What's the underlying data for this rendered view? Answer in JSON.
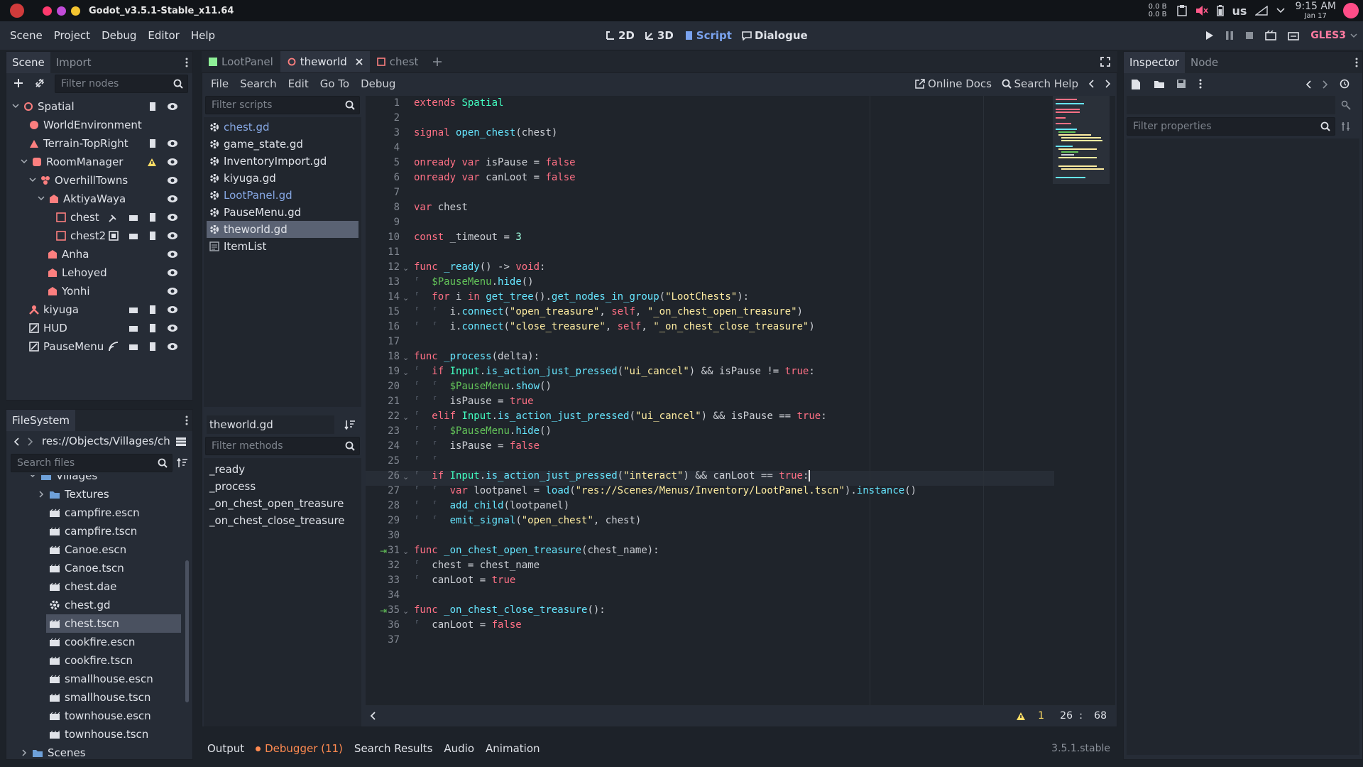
{
  "window": {
    "title": "Godot_v3.5.1-Stable_x11.64",
    "net_up": "0.0 B",
    "net_down": "0.0 B",
    "keyboard": "us",
    "time": "9:15 AM",
    "date": "Jan 17"
  },
  "menu": [
    "Scene",
    "Project",
    "Debug",
    "Editor",
    "Help"
  ],
  "workspaces": [
    {
      "label": "2D"
    },
    {
      "label": "3D"
    },
    {
      "label": "Script"
    },
    {
      "label": "Dialogue"
    }
  ],
  "renderer": "GLES3",
  "scene_dock": {
    "tabs": [
      "Scene",
      "Import"
    ],
    "filter_placeholder": "Filter nodes",
    "nodes": [
      {
        "label": "Spatial"
      },
      {
        "label": "WorldEnvironment"
      },
      {
        "label": "Terrain-TopRight"
      },
      {
        "label": "RoomManager"
      },
      {
        "label": "OverhillTowns"
      },
      {
        "label": "AktiyaWaya"
      },
      {
        "label": "chest"
      },
      {
        "label": "chest2"
      },
      {
        "label": "Anha"
      },
      {
        "label": "Lehoyed"
      },
      {
        "label": "Yonhi"
      },
      {
        "label": "kiyuga"
      },
      {
        "label": "HUD"
      },
      {
        "label": "PauseMenu"
      }
    ]
  },
  "filesystem": {
    "title": "FileSystem",
    "path": "res://Objects/Villages/che",
    "search_placeholder": "Search files",
    "items": [
      {
        "label": "Villages"
      },
      {
        "label": "Textures"
      },
      {
        "label": "campfire.escn"
      },
      {
        "label": "campfire.tscn"
      },
      {
        "label": "Canoe.escn"
      },
      {
        "label": "Canoe.tscn"
      },
      {
        "label": "chest.dae"
      },
      {
        "label": "chest.gd"
      },
      {
        "label": "chest.tscn"
      },
      {
        "label": "cookfire.escn"
      },
      {
        "label": "cookfire.tscn"
      },
      {
        "label": "smallhouse.escn"
      },
      {
        "label": "smallhouse.tscn"
      },
      {
        "label": "townhouse.escn"
      },
      {
        "label": "townhouse.tscn"
      },
      {
        "label": "Scenes"
      }
    ]
  },
  "editor_tabs": [
    {
      "label": "LootPanel"
    },
    {
      "label": "theworld"
    },
    {
      "label": "chest"
    }
  ],
  "script_menu": [
    "File",
    "Search",
    "Edit",
    "Go To",
    "Debug"
  ],
  "online_docs": "Online Docs",
  "search_help": "Search Help",
  "scripts": {
    "filter_placeholder": "Filter scripts",
    "items": [
      {
        "label": "chest.gd"
      },
      {
        "label": "game_state.gd"
      },
      {
        "label": "InventoryImport.gd"
      },
      {
        "label": "kiyuga.gd"
      },
      {
        "label": "LootPanel.gd"
      },
      {
        "label": "PauseMenu.gd"
      },
      {
        "label": "theworld.gd"
      },
      {
        "label": "ItemList"
      }
    ]
  },
  "methods": {
    "current": "theworld.gd",
    "filter_placeholder": "Filter methods",
    "items": [
      "_ready",
      "_process",
      "_on_chest_open_treasure",
      "_on_chest_close_treasure"
    ]
  },
  "code_lines": [
    "1",
    "2",
    "3",
    "4",
    "5",
    "6",
    "7",
    "8",
    "9",
    "10",
    "11",
    "12",
    "13",
    "14",
    "15",
    "16",
    "17",
    "18",
    "19",
    "20",
    "21",
    "22",
    "23",
    "24",
    "25",
    "26",
    "27",
    "28",
    "29",
    "30",
    "31",
    "32",
    "33",
    "34",
    "35",
    "36",
    "37"
  ],
  "status": {
    "warnings": "1",
    "line": "26",
    "sep": ":",
    "col": "68"
  },
  "bottom_tabs": [
    "Output",
    "Debugger (11)",
    "Search Results",
    "Audio",
    "Animation"
  ],
  "version": "3.5.1.stable",
  "inspector": {
    "tabs": [
      "Inspector",
      "Node"
    ],
    "filter_placeholder": "Filter properties"
  }
}
